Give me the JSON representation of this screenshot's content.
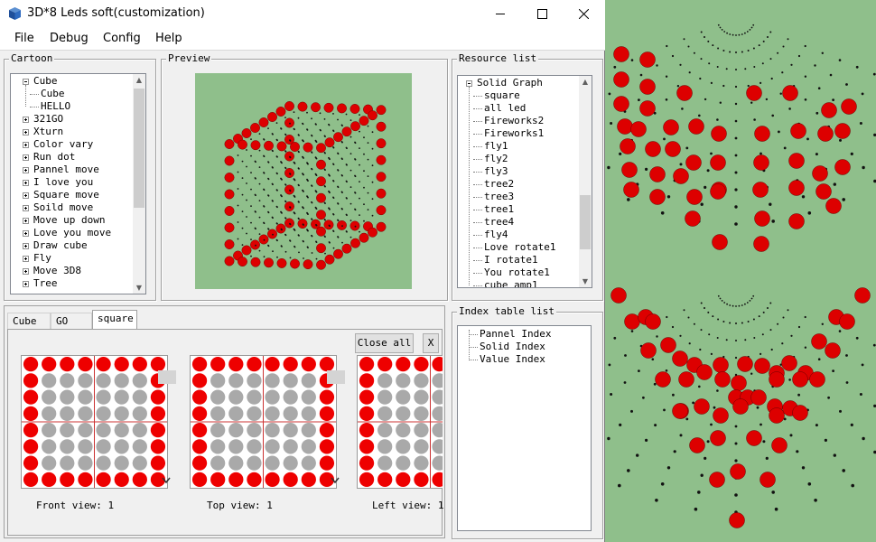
{
  "window": {
    "title": "3D*8 Leds soft(customization)"
  },
  "menu": [
    "File",
    "Debug",
    "Config",
    "Help"
  ],
  "groups": {
    "cartoon": "Cartoon",
    "preview": "Preview",
    "resource": "Resource list",
    "index": "Index table list"
  },
  "cartoon_tree": [
    {
      "label": "Cube",
      "level": 0,
      "expanded": true
    },
    {
      "label": "Cube",
      "level": 1
    },
    {
      "label": "HELLO",
      "level": 1
    },
    {
      "label": "321GO",
      "level": 0
    },
    {
      "label": "Xturn",
      "level": 0
    },
    {
      "label": "Color vary",
      "level": 0
    },
    {
      "label": "Run dot",
      "level": 0
    },
    {
      "label": "Pannel move",
      "level": 0
    },
    {
      "label": "I love you",
      "level": 0
    },
    {
      "label": "Square move",
      "level": 0
    },
    {
      "label": "Soild move",
      "level": 0
    },
    {
      "label": "Move up down",
      "level": 0
    },
    {
      "label": "Love you move",
      "level": 0
    },
    {
      "label": "Draw cube",
      "level": 0
    },
    {
      "label": "Fly",
      "level": 0
    },
    {
      "label": "Move 3D8",
      "level": 0
    },
    {
      "label": "Tree",
      "level": 0
    }
  ],
  "resource_tree": [
    {
      "label": "Solid Graph",
      "level": 0,
      "expanded": true
    },
    {
      "label": "square",
      "level": 1
    },
    {
      "label": "all led",
      "level": 1
    },
    {
      "label": "Fireworks2",
      "level": 1
    },
    {
      "label": "Fireworks1",
      "level": 1
    },
    {
      "label": "fly1",
      "level": 1
    },
    {
      "label": "fly2",
      "level": 1
    },
    {
      "label": "fly3",
      "level": 1
    },
    {
      "label": "tree2",
      "level": 1
    },
    {
      "label": "tree3",
      "level": 1
    },
    {
      "label": "tree1",
      "level": 1
    },
    {
      "label": "tree4",
      "level": 1
    },
    {
      "label": "fly4",
      "level": 1
    },
    {
      "label": "Love rotate1",
      "level": 1
    },
    {
      "label": "I rotate1",
      "level": 1
    },
    {
      "label": "You rotate1",
      "level": 1
    },
    {
      "label": "cube_amp1",
      "level": 1
    }
  ],
  "index_tree": [
    "Pannel Index",
    "Solid Index",
    "Value Index"
  ],
  "tabs": [
    {
      "label": "Cube",
      "active": false
    },
    {
      "label": "GO",
      "active": false
    },
    {
      "label": "square",
      "active": true
    }
  ],
  "buttons": {
    "close_all": "Close all",
    "x": "X"
  },
  "views": [
    {
      "caption": "Front view: 1"
    },
    {
      "caption": "Top view: 1"
    },
    {
      "caption": "Left view: 1"
    }
  ],
  "led_grid_rows": [
    "11111111",
    "10000001",
    "10000001",
    "10000001",
    "10000001",
    "10000001",
    "10000001",
    "11111111"
  ],
  "colors": {
    "led_on": "#ee0000",
    "led_off": "#a9a9a9",
    "preview_bg": "#8fbf8b",
    "ball": "#dd0000"
  }
}
